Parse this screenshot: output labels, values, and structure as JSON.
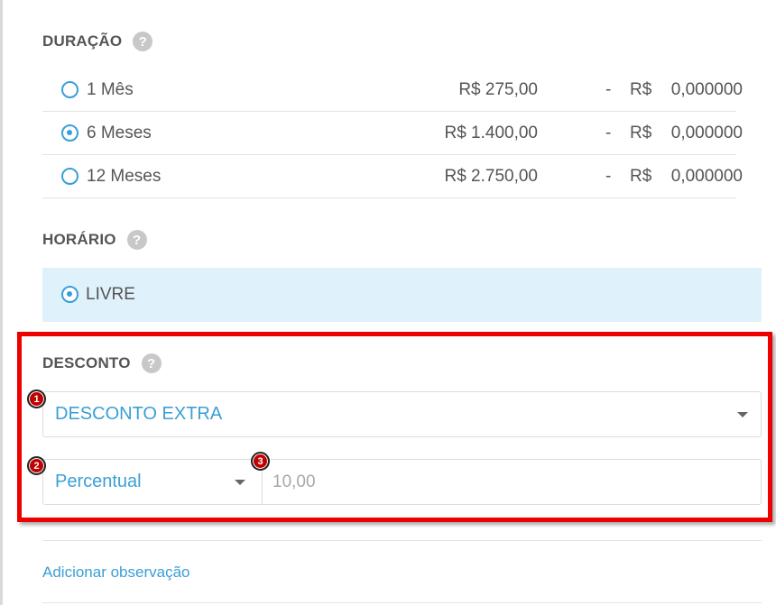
{
  "duracao": {
    "title": "DURAÇÃO",
    "help_icon": "?",
    "options": [
      {
        "label": "1 Mês",
        "price": "R$ 275,00",
        "dash": "-",
        "currency": "R$",
        "value": "0,000000",
        "selected": false
      },
      {
        "label": "6 Meses",
        "price": "R$ 1.400,00",
        "dash": "-",
        "currency": "R$",
        "value": "0,000000",
        "selected": true
      },
      {
        "label": "12 Meses",
        "price": "R$ 2.750,00",
        "dash": "-",
        "currency": "R$",
        "value": "0,000000",
        "selected": false
      }
    ]
  },
  "horario": {
    "title": "HORÁRIO",
    "help_icon": "?",
    "option": {
      "label": "LIVRE",
      "selected": true
    }
  },
  "desconto": {
    "title": "DESCONTO",
    "help_icon": "?",
    "type_select": "DESCONTO EXTRA",
    "mode_select": "Percentual",
    "amount_placeholder": "10,00",
    "markers": [
      "1",
      "2",
      "3"
    ]
  },
  "footer": {
    "link_label": "Adicionar observação"
  },
  "colors": {
    "accent": "#3a9fd6",
    "highlight_bg": "#dff1fb",
    "annotation_red": "#ee0000"
  }
}
